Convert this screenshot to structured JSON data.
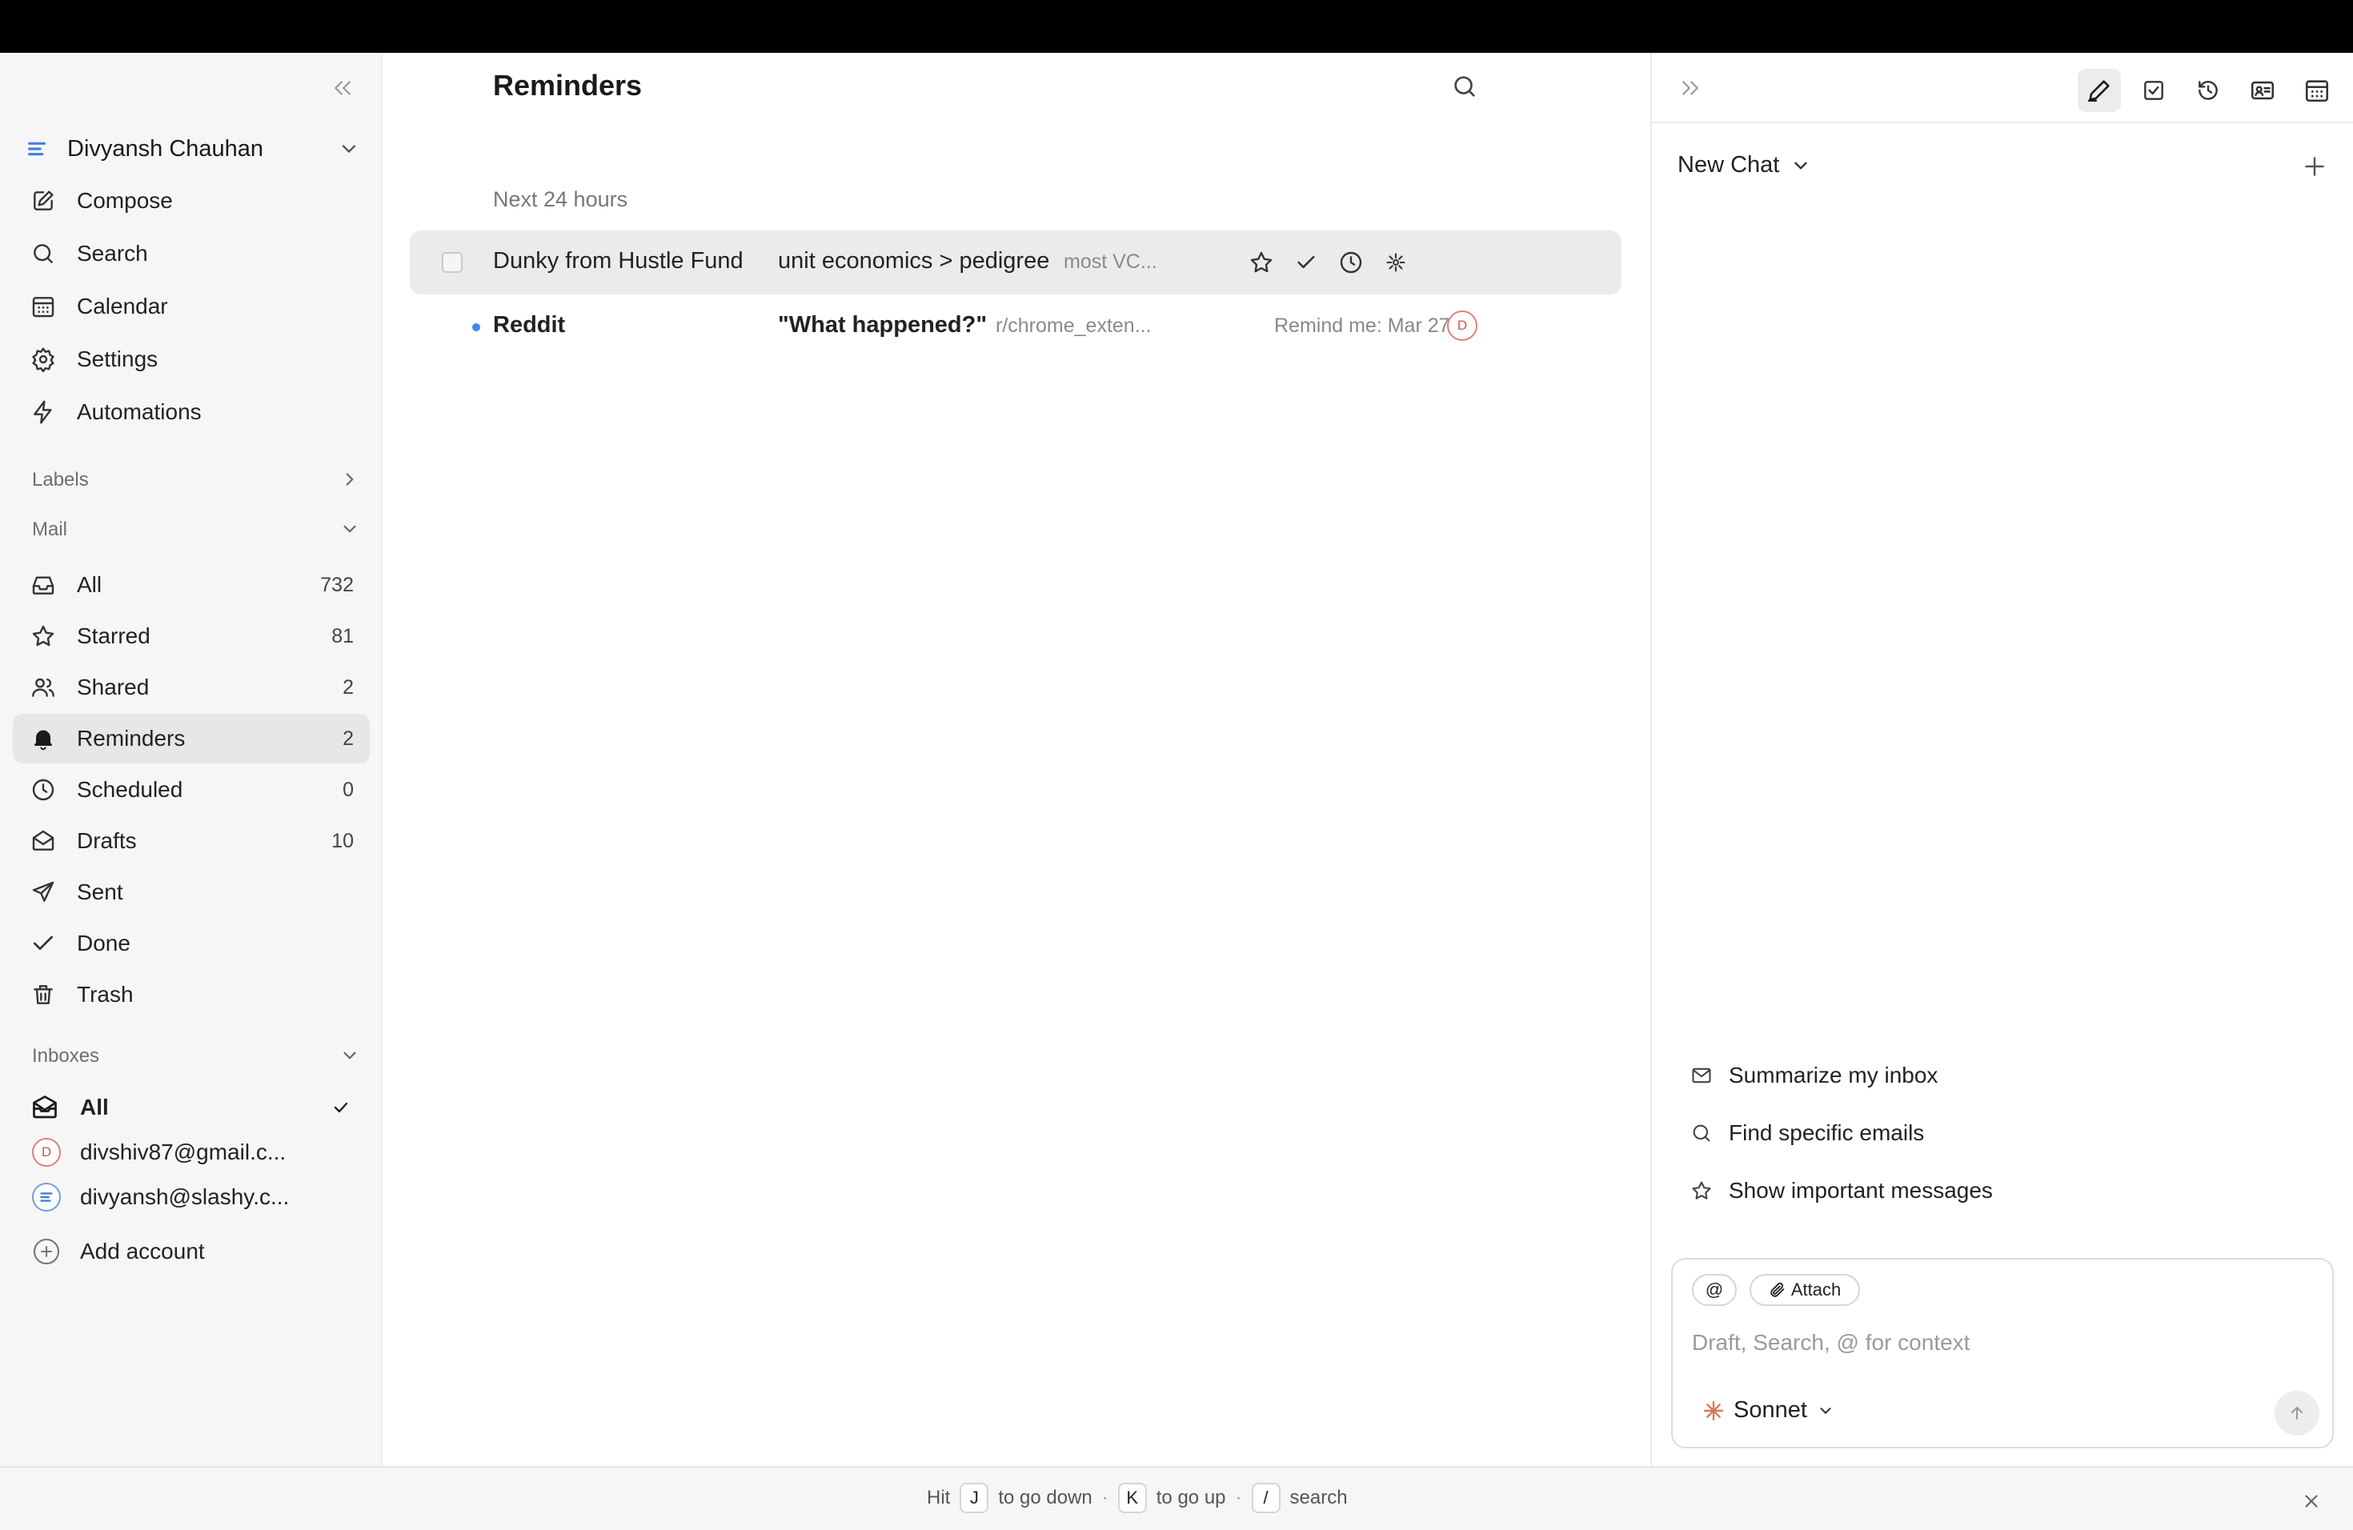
{
  "sidebar": {
    "account_name": "Divyansh Chauhan",
    "nav": [
      {
        "label": "Compose"
      },
      {
        "label": "Search"
      },
      {
        "label": "Calendar"
      },
      {
        "label": "Settings"
      },
      {
        "label": "Automations"
      }
    ],
    "labels_header": "Labels",
    "mail_header": "Mail",
    "mail": [
      {
        "label": "All",
        "count": "732"
      },
      {
        "label": "Starred",
        "count": "81"
      },
      {
        "label": "Shared",
        "count": "2"
      },
      {
        "label": "Reminders",
        "count": "2"
      },
      {
        "label": "Scheduled",
        "count": "0"
      },
      {
        "label": "Drafts",
        "count": "10"
      },
      {
        "label": "Sent"
      },
      {
        "label": "Done"
      },
      {
        "label": "Trash"
      }
    ],
    "inboxes_header": "Inboxes",
    "inboxes": [
      {
        "label": "All",
        "avatar": ""
      },
      {
        "label": "divshiv87@gmail.c...",
        "avatar": "D"
      },
      {
        "label": "divyansh@slashy.c...",
        "avatar": ""
      }
    ],
    "add_account": "Add account"
  },
  "main": {
    "title": "Reminders",
    "group": "Next 24 hours",
    "emails": [
      {
        "sender": "Dunky from Hustle Fund",
        "subject": "unit economics > pedigree",
        "snippet": "most VC..."
      },
      {
        "sender": "Reddit",
        "subject": "\"What happened?\"",
        "snippet": "r/chrome_exten...",
        "remind": "Remind me: Mar 27",
        "avatar": "D"
      }
    ]
  },
  "right_panel": {
    "chat_title": "New Chat",
    "suggestions": [
      {
        "label": "Summarize my inbox",
        "icon": "mail-icon"
      },
      {
        "label": "Find specific emails",
        "icon": "search-icon"
      },
      {
        "label": "Show important messages",
        "icon": "star-icon"
      }
    ],
    "composer": {
      "mention_label": "@",
      "attach_label": "Attach",
      "placeholder": "Draft, Search, @ for context",
      "model": "Sonnet"
    }
  },
  "footer": {
    "hit": "Hit",
    "key_down": "J",
    "down_text": "to go down",
    "key_up": "K",
    "up_text": "to go up",
    "key_search": "/",
    "search_text": "search",
    "separator": "·"
  },
  "colors": {
    "accent_blue": "#3d8be6",
    "avatar_red": "#d4534a",
    "sonnet_orange": "#d97757"
  }
}
